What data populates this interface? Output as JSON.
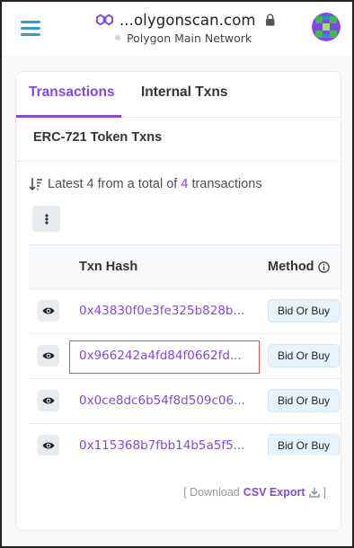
{
  "header": {
    "url": "...olygonscan.com",
    "network": "Polygon Main Network"
  },
  "tabs": {
    "transactions": "Transactions",
    "internal": "Internal Txns",
    "erc721": "ERC-721 Token Txns"
  },
  "summary": {
    "prefix": "Latest",
    "shown": "4",
    "middle": "from a total of",
    "total": "4",
    "suffix": "transactions"
  },
  "table": {
    "col_hash": "Txn Hash",
    "col_method": "Method",
    "rows": [
      {
        "hash": "0x43830f0e3fe325b828b...",
        "method": "Bid Or Buy"
      },
      {
        "hash": "0x966242a4fd84f0662fd...",
        "method": "Bid Or Buy"
      },
      {
        "hash": "0x0ce8dc6b54f8d509c06...",
        "method": "Bid Or Buy"
      },
      {
        "hash": "0x115368b7fbb14b5a5f5...",
        "method": "Bid Or Buy"
      }
    ]
  },
  "footer": {
    "open": "[ Download",
    "csv": "CSV Export",
    "close": "]"
  },
  "colors": {
    "accent": "#8247e5",
    "link_blue": "#3498db",
    "highlight": "#e74c3c"
  },
  "icons": [
    "menu-icon",
    "polygon-logo-icon",
    "lock-icon",
    "sort-icon",
    "more-vertical-icon",
    "eye-icon",
    "info-icon",
    "download-icon"
  ]
}
